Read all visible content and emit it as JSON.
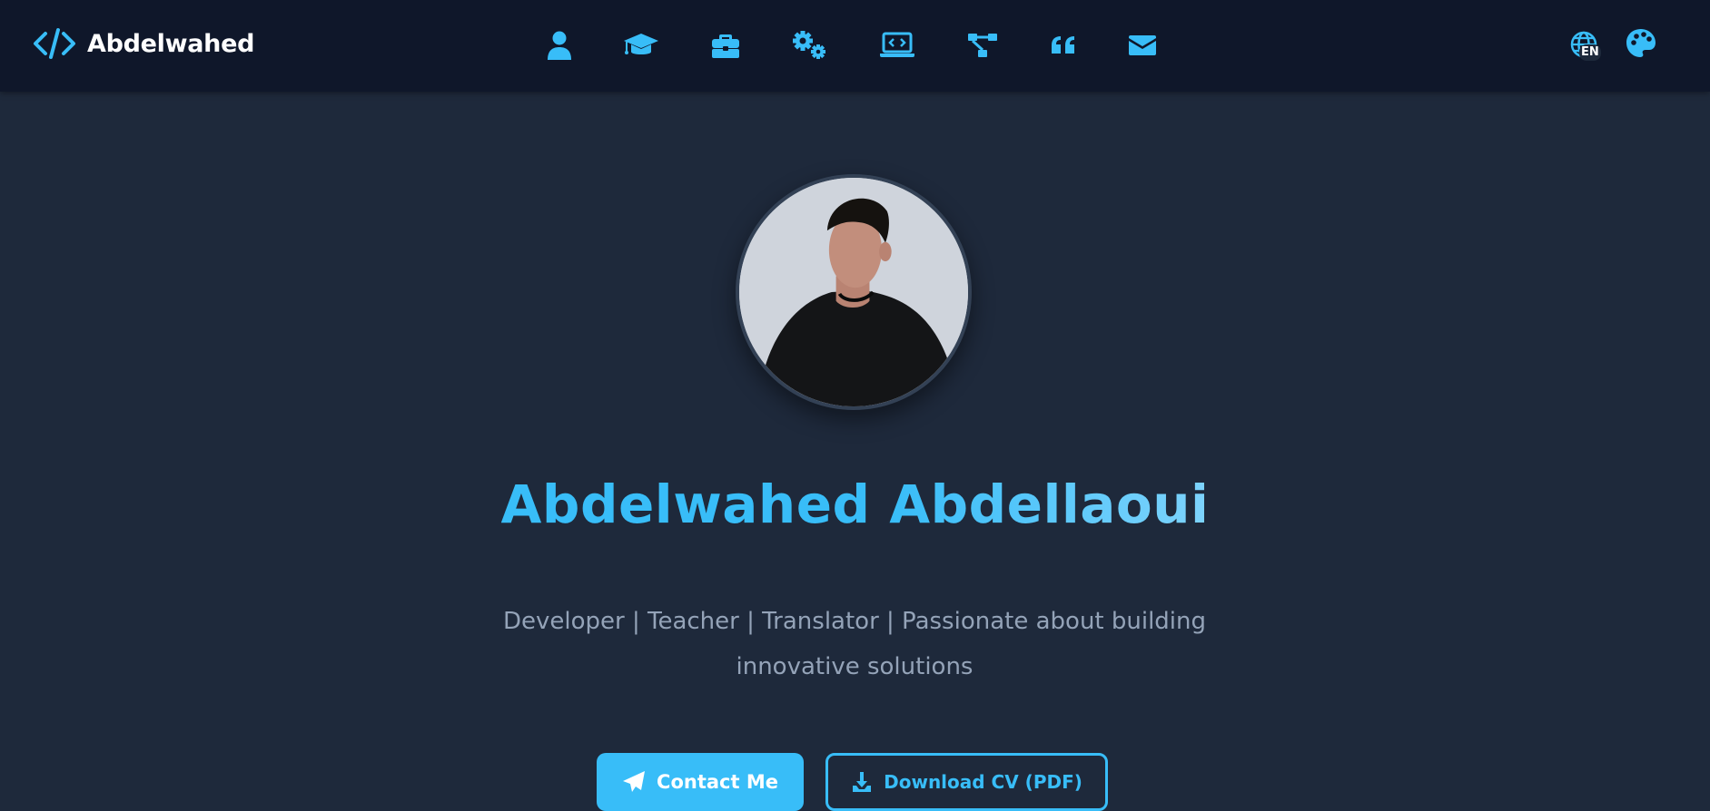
{
  "header": {
    "brand_name": "Abdelwahed",
    "brand_icon": "code-icon",
    "nav_items": [
      {
        "icon": "user-icon",
        "target": "about"
      },
      {
        "icon": "graduation-cap-icon",
        "target": "education"
      },
      {
        "icon": "briefcase-icon",
        "target": "experience"
      },
      {
        "icon": "gears-icon",
        "target": "skills"
      },
      {
        "icon": "laptop-code-icon",
        "target": "projects"
      },
      {
        "icon": "diagram-icon",
        "target": "structure"
      },
      {
        "icon": "quote-icon",
        "target": "testimonials"
      },
      {
        "icon": "envelope-icon",
        "target": "contact"
      }
    ],
    "language": {
      "icon": "globe-icon",
      "code": "EN"
    },
    "theme": {
      "icon": "palette-icon"
    }
  },
  "hero": {
    "name": "Abdelwahed Abdellaoui",
    "tagline_line1": "Developer | Teacher | Translator | Passionate about building",
    "tagline_line2": "innovative solutions",
    "contact_button": "Contact Me",
    "cv_button": "Download CV (PDF)"
  },
  "colors": {
    "accent": "#38bdf8",
    "navbar_bg": "#0f172a",
    "page_bg": "#1e293b",
    "muted_text": "#94a3b8"
  }
}
